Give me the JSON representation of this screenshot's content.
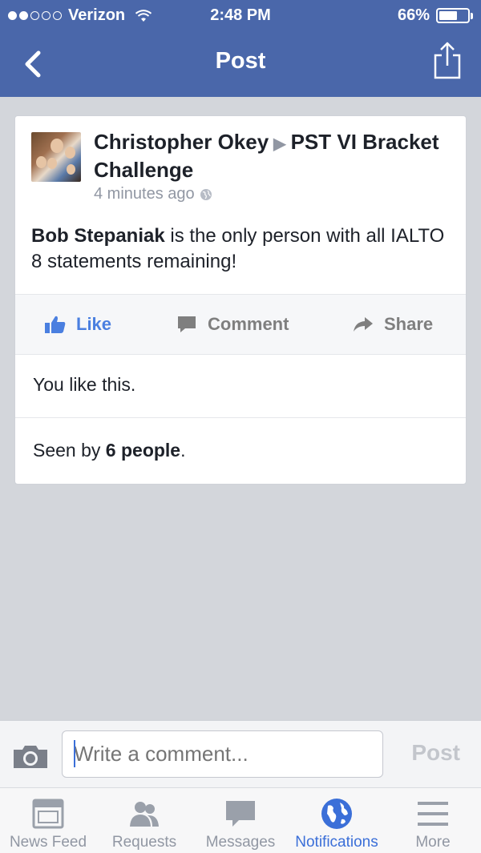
{
  "status_bar": {
    "carrier": "Verizon",
    "time": "2:48 PM",
    "battery": "66%",
    "battery_level": 0.66,
    "signal_bars_filled": 2,
    "signal_bars_total": 5
  },
  "nav": {
    "title": "Post",
    "back_icon": "chevron-left-icon",
    "share_icon": "share-icon"
  },
  "post": {
    "author": "Christopher Okey",
    "target": "PST VI Bracket Challenge",
    "timestamp": "4 minutes ago",
    "privacy_icon": "globe-icon",
    "text_bold": "Bob Stepaniak",
    "text_rest": " is the only person with all IALTO 8 statements remaining!",
    "actions": {
      "like": "Like",
      "comment": "Comment",
      "share": "Share"
    },
    "likes_text": "You like this.",
    "seen_prefix": "Seen by ",
    "seen_count": "6 people",
    "seen_suffix": "."
  },
  "comment_bar": {
    "placeholder": "Write a comment...",
    "post_label": "Post"
  },
  "tabs": [
    {
      "label": "News Feed",
      "icon": "news-feed-icon",
      "active": false
    },
    {
      "label": "Requests",
      "icon": "friends-icon",
      "active": false
    },
    {
      "label": "Messages",
      "icon": "messages-icon",
      "active": false
    },
    {
      "label": "Notifications",
      "icon": "globe-icon",
      "active": true
    },
    {
      "label": "More",
      "icon": "menu-icon",
      "active": false
    }
  ],
  "colors": {
    "header": "#4a67aa",
    "accent": "#3b6fd8",
    "like_blue": "#4a7fe0"
  }
}
